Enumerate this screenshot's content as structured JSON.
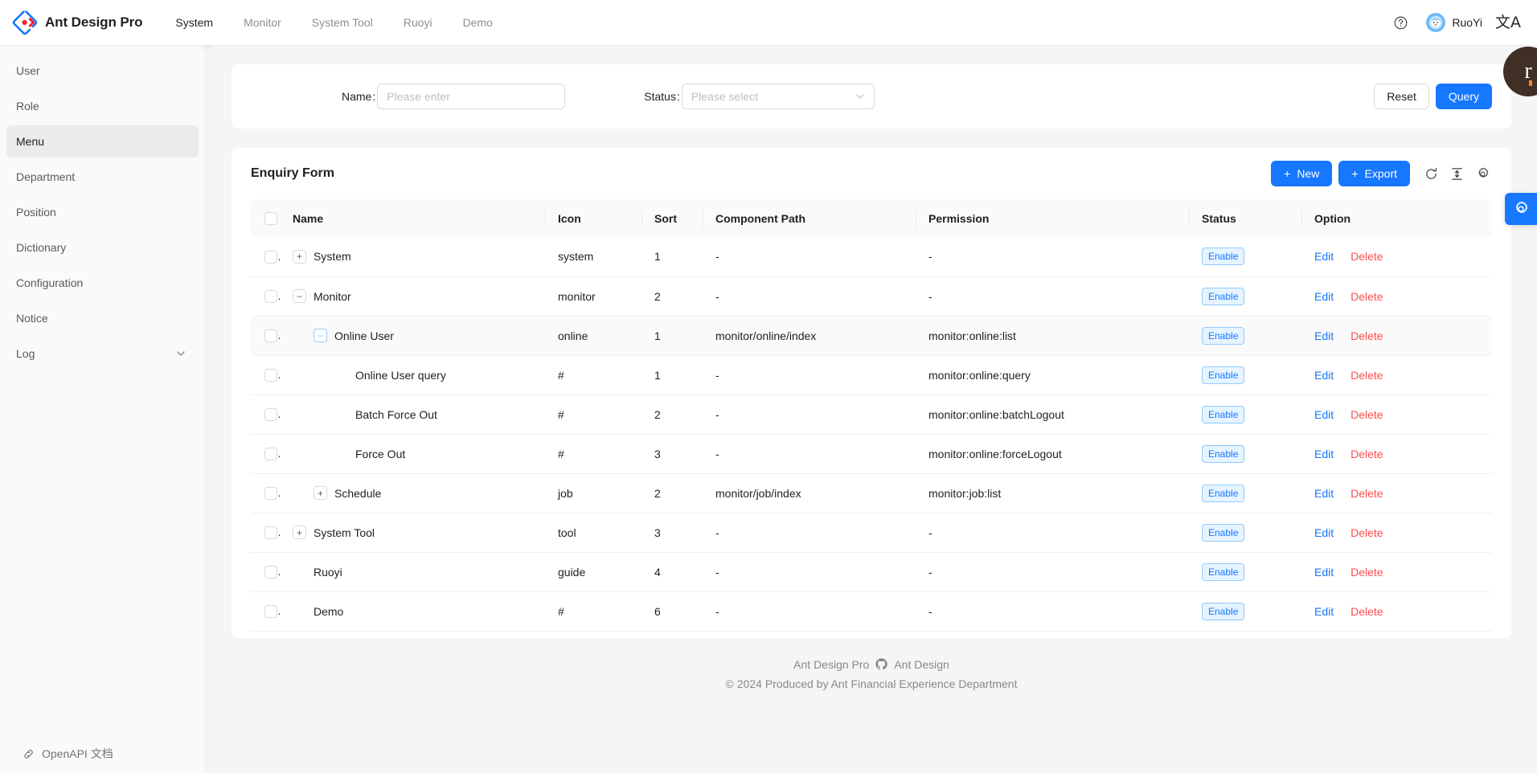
{
  "header": {
    "brand": "Ant Design Pro",
    "nav": [
      {
        "label": "System",
        "active": true
      },
      {
        "label": "Monitor",
        "active": false
      },
      {
        "label": "System Tool",
        "active": false
      },
      {
        "label": "Ruoyi",
        "active": false
      },
      {
        "label": "Demo",
        "active": false
      }
    ],
    "help_icon": "question-circle-icon",
    "user_name": "RuoYi",
    "lang_icon": "translate-icon",
    "lang_glyph": "文A"
  },
  "sidebar": {
    "items": [
      {
        "label": "User",
        "selected": false,
        "expandable": false
      },
      {
        "label": "Role",
        "selected": false,
        "expandable": false
      },
      {
        "label": "Menu",
        "selected": true,
        "expandable": false
      },
      {
        "label": "Department",
        "selected": false,
        "expandable": false
      },
      {
        "label": "Position",
        "selected": false,
        "expandable": false
      },
      {
        "label": "Dictionary",
        "selected": false,
        "expandable": false
      },
      {
        "label": "Configuration",
        "selected": false,
        "expandable": false
      },
      {
        "label": "Notice",
        "selected": false,
        "expandable": false
      },
      {
        "label": "Log",
        "selected": false,
        "expandable": true
      }
    ],
    "collapse_icon": "chevron-left-icon",
    "footer_link": "OpenAPI 文档",
    "footer_icon": "link-icon"
  },
  "search": {
    "name_label": "Name",
    "name_placeholder": "Please enter",
    "name_value": "",
    "status_label": "Status",
    "status_placeholder": "Please select",
    "reset_label": "Reset",
    "query_label": "Query"
  },
  "table": {
    "title": "Enquiry Form",
    "new_label": "New",
    "export_label": "Export",
    "reload_icon": "reload-icon",
    "density_icon": "column-height-icon",
    "setting_icon": "gear-icon",
    "columns": [
      "Name",
      "Icon",
      "Sort",
      "Component Path",
      "Permission",
      "Status",
      "Option"
    ],
    "edit_label": "Edit",
    "delete_label": "Delete",
    "rows": [
      {
        "name": "System",
        "indent": 0,
        "toggle": "plus",
        "toggle_active": false,
        "icon": "system",
        "sort": "1",
        "path": "-",
        "permission": "-",
        "status": "Enable",
        "hovered": false
      },
      {
        "name": "Monitor",
        "indent": 0,
        "toggle": "minus",
        "toggle_active": false,
        "icon": "monitor",
        "sort": "2",
        "path": "-",
        "permission": "-",
        "status": "Enable",
        "hovered": false
      },
      {
        "name": "Online User",
        "indent": 1,
        "toggle": "minus",
        "toggle_active": true,
        "icon": "online",
        "sort": "1",
        "path": "monitor/online/index",
        "permission": "monitor:online:list",
        "status": "Enable",
        "hovered": true
      },
      {
        "name": "Online User query",
        "indent": 2,
        "toggle": "none",
        "toggle_active": false,
        "icon": "#",
        "sort": "1",
        "path": "-",
        "permission": "monitor:online:query",
        "status": "Enable",
        "hovered": false
      },
      {
        "name": "Batch Force Out",
        "indent": 2,
        "toggle": "none",
        "toggle_active": false,
        "icon": "#",
        "sort": "2",
        "path": "-",
        "permission": "monitor:online:batchLogout",
        "status": "Enable",
        "hovered": false
      },
      {
        "name": "Force Out",
        "indent": 2,
        "toggle": "none",
        "toggle_active": false,
        "icon": "#",
        "sort": "3",
        "path": "-",
        "permission": "monitor:online:forceLogout",
        "status": "Enable",
        "hovered": false
      },
      {
        "name": "Schedule",
        "indent": 1,
        "toggle": "plus",
        "toggle_active": false,
        "icon": "job",
        "sort": "2",
        "path": "monitor/job/index",
        "permission": "monitor:job:list",
        "status": "Enable",
        "hovered": false
      },
      {
        "name": "System Tool",
        "indent": 0,
        "toggle": "plus",
        "toggle_active": false,
        "icon": "tool",
        "sort": "3",
        "path": "-",
        "permission": "-",
        "status": "Enable",
        "hovered": false
      },
      {
        "name": "Ruoyi",
        "indent": 0,
        "toggle": "none",
        "toggle_active": false,
        "icon": "guide",
        "sort": "4",
        "path": "-",
        "permission": "-",
        "status": "Enable",
        "hovered": false
      },
      {
        "name": "Demo",
        "indent": 0,
        "toggle": "none",
        "toggle_active": false,
        "icon": "#",
        "sort": "6",
        "path": "-",
        "permission": "-",
        "status": "Enable",
        "hovered": false
      }
    ]
  },
  "footer": {
    "link1": "Ant Design Pro",
    "github_icon": "github-icon",
    "link2": "Ant Design",
    "copyright": "2024 Produced by Ant Financial Experience Department",
    "copyright_symbol": "©"
  },
  "floating": {
    "settings_icon": "gear-icon",
    "avatar_letter": "r"
  }
}
